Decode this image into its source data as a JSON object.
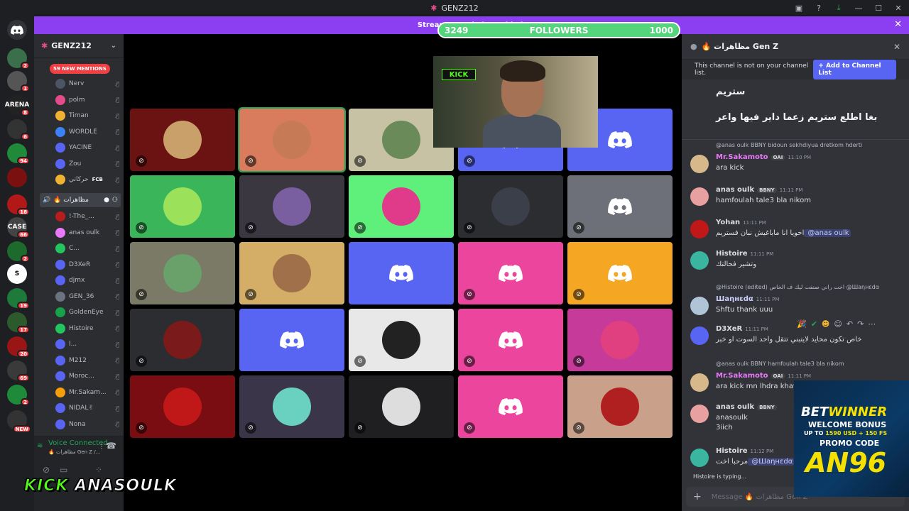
{
  "window": {
    "title": "GENZ212"
  },
  "banner": {
    "text": "Streamer Mode is enabled."
  },
  "followers": {
    "current": "3249",
    "label": "FOLLOWERS",
    "goal": "1000",
    "progress": 1.0
  },
  "server": {
    "name": "GENZ212",
    "new_mentions": "59 NEW MENTIONS"
  },
  "rail": [
    {
      "badge": "",
      "color": "#5865f2"
    },
    {
      "badge": "2",
      "color": "#3b6e4a"
    },
    {
      "badge": "1",
      "color": "#555"
    },
    {
      "badge": "8",
      "color": "#222",
      "text": "ARENA"
    },
    {
      "badge": "6",
      "color": "#333"
    },
    {
      "badge": "94",
      "color": "#1f8a3a"
    },
    {
      "badge": "",
      "color": "#7a1010"
    },
    {
      "badge": "18",
      "color": "#b31818"
    },
    {
      "badge": "66",
      "color": "#444",
      "text": "CASE"
    },
    {
      "badge": "2",
      "color": "#1c6b2c"
    },
    {
      "badge": "",
      "color": "#fff",
      "text": "S"
    },
    {
      "badge": "19",
      "color": "#1d7a3a"
    },
    {
      "badge": "17",
      "color": "#2d5a2d"
    },
    {
      "badge": "20",
      "color": "#9a1515"
    },
    {
      "badge": "69",
      "color": "#3a3a3a"
    },
    {
      "badge": "2",
      "color": "#1f8a3a"
    },
    {
      "badge": "NEW",
      "color": "#333"
    }
  ],
  "sidebar": {
    "users_top": [
      "Nerv",
      "polm",
      "Timan",
      "WORDLE",
      "YACINE",
      "Zou",
      "حركاتي"
    ],
    "fcb_label": "FCB",
    "voice_channel": "🔥 مظاهرات",
    "users": [
      "!-The_...",
      "anas oulk",
      "C...",
      "D3XeR",
      "djmx",
      "GEN_36",
      "GoldenEye",
      "Histoire",
      "l...",
      "M212",
      "Moroc...",
      "Mr.Sakam...",
      "NIDAL✌",
      "Nona"
    ],
    "voice_connected": "Voice Connected",
    "voice_sub": "🔥 مظاهرات Gen Z /..."
  },
  "chat": {
    "header": "🔥 مظاهرات Gen Z",
    "notice": "This channel is not on your channel list.",
    "add_button": "+ Add to Channel List",
    "top_lines": [
      "ستريم",
      "بغا اطلع ستريم زعما داير فيها واعر"
    ],
    "messages": [
      {
        "reply": "@anas oulk  BBNY  bidoun sekhdiyua dretkom hderti",
        "name": "Mr.Sakamoto",
        "tag": "OAI",
        "time": "11:10 PM",
        "text": "ara kick",
        "color": "#e879f9"
      },
      {
        "name": "anas oulk",
        "tag": "BBNY",
        "time": "11:11 PM",
        "text": "hamfoulah tale3 bla nikom",
        "color": "#dbdee1"
      },
      {
        "name": "Yohan",
        "time": "11:11 PM",
        "text": "اخويا انا ماباغيش نبان فستريم",
        "mention": "@anas oulk",
        "color": "#dbdee1"
      },
      {
        "name": "Histoire",
        "time": "11:11 PM",
        "text": "وتشير فحالتك",
        "color": "#dbdee1"
      },
      {
        "reply": "@Histoire (edited) اخت راني صنفت ليك ف الخاص @Шaηнεdα",
        "name": "Шaηнεdα",
        "time": "11:11 PM",
        "text": "Shftu thank uuu",
        "color": "#c9cdfb"
      },
      {
        "name": "D3XeR",
        "time": "11:11 PM",
        "text": "خاص تكون محايد لايتبني تتقل واحد السوت او خبر",
        "color": "#dbdee1"
      },
      {
        "reply": "@anas oulk  BBNY  hamfoulah tale3 bla nikom",
        "name": "Mr.Sakamoto",
        "tag": "OAI",
        "time": "11:11 PM",
        "text": "ara kick mn lhdra khawia",
        "color": "#e879f9"
      },
      {
        "name": "anas oulk",
        "tag": "BBNY",
        "time": "",
        "text": "anasoulk",
        "text2": "3iich",
        "color": "#dbdee1"
      },
      {
        "name": "Histoire",
        "time": "11:12 PM",
        "text": "مرحبا اخت",
        "mention": "@Шaηнεdα",
        "color": "#dbdee1"
      }
    ],
    "typing": "Histoire is typing...",
    "placeholder": "Message 🔥 مظاهرات Gen Z"
  },
  "ad": {
    "brand_a": "BET",
    "brand_b": "WINNER",
    "welcome": "WELCOME BONUS",
    "up_to": "UP TO",
    "amount": "1590 USD + 150 FS",
    "promo_label": "PROMO CODE",
    "code": "AN96"
  },
  "watermark": {
    "a": "KICK",
    "b": "ANASOULK"
  }
}
